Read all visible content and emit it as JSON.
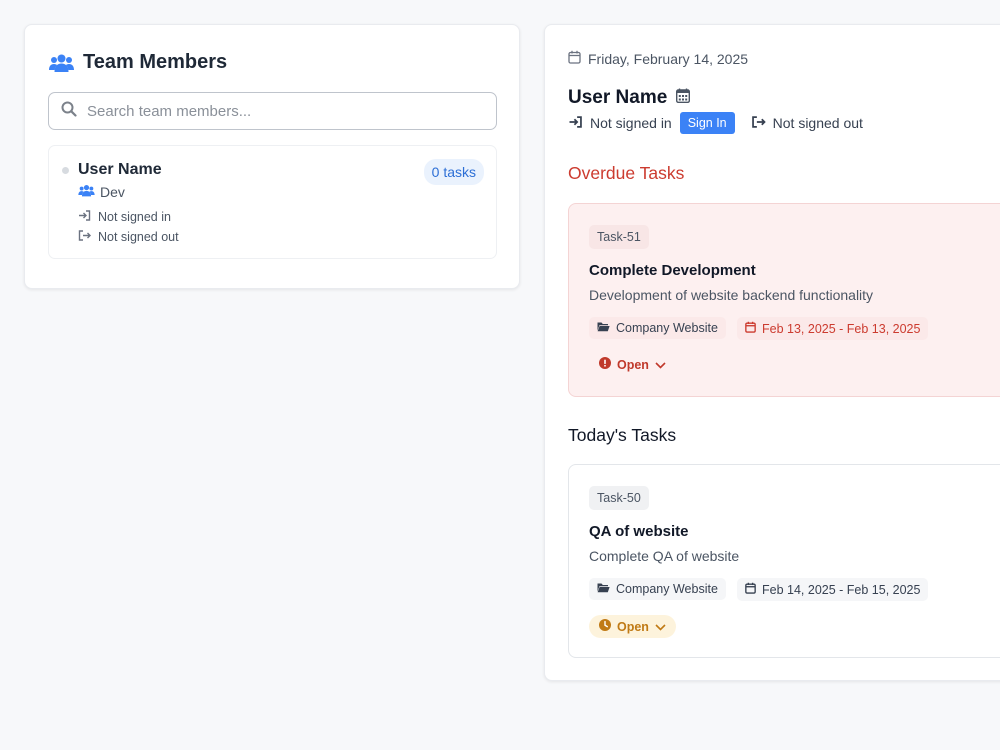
{
  "team": {
    "title": "Team Members",
    "search_placeholder": "Search team members...",
    "members": [
      {
        "name": "User Name",
        "role": "Dev",
        "task_count": "0 tasks",
        "signed_in": "Not signed in",
        "signed_out": "Not signed out"
      }
    ]
  },
  "main": {
    "date": "Friday, February 14, 2025",
    "user_name": "User Name",
    "signed_in": "Not signed in",
    "sign_in_label": "Sign In",
    "signed_out": "Not signed out",
    "overdue_title": "Overdue Tasks",
    "today_title": "Today's Tasks",
    "overdue_tasks": [
      {
        "id": "Task-51",
        "title": "Complete Development",
        "description": "Development of website backend functionality",
        "project": "Company Website",
        "dates": "Feb 13, 2025 - Feb 13, 2025",
        "status": "Open"
      }
    ],
    "today_tasks": [
      {
        "id": "Task-50",
        "title": "QA of website",
        "description": "Complete QA of website",
        "project": "Company Website",
        "dates": "Feb 14, 2025 - Feb 15, 2025",
        "status": "Open"
      }
    ]
  },
  "colors": {
    "accent": "#3b82f6",
    "overdue": "#cc3b2f",
    "pending": "#c07a15",
    "team_icon": "#3b82f6"
  },
  "icons": {
    "team": "users-icon",
    "search": "search-icon",
    "calendar": "calendar-icon",
    "sign_in": "sign-in-icon",
    "sign_out": "sign-out-icon",
    "folder": "folder-icon",
    "alert": "alert-circle-icon",
    "clock": "clock-icon",
    "chevron": "chevron-down-icon"
  }
}
